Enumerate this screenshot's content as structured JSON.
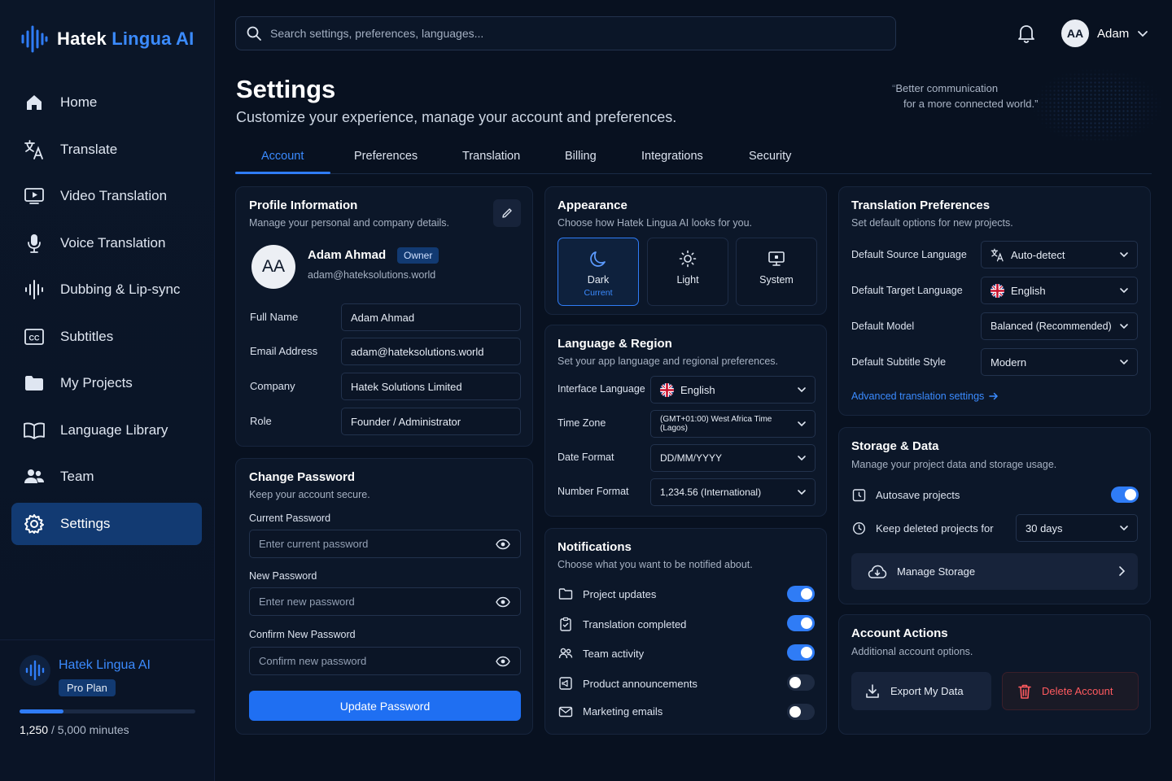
{
  "app": {
    "brand_main": "Hatek",
    "brand_accent": "Lingua AI",
    "accent_color": "#2f7cf6",
    "background_color": "#081120"
  },
  "sidebar": {
    "items": [
      {
        "label": "Home",
        "icon": "home-icon"
      },
      {
        "label": "Translate",
        "icon": "translate-icon"
      },
      {
        "label": "Video Translation",
        "icon": "video-icon"
      },
      {
        "label": "Voice Translation",
        "icon": "microphone-icon"
      },
      {
        "label": "Dubbing & Lip-sync",
        "icon": "waveform-icon"
      },
      {
        "label": "Subtitles",
        "icon": "cc-icon"
      },
      {
        "label": "My Projects",
        "icon": "folder-icon"
      },
      {
        "label": "Language Library",
        "icon": "book-icon"
      },
      {
        "label": "Team",
        "icon": "team-icon"
      },
      {
        "label": "Settings",
        "icon": "gear-icon",
        "active": true
      }
    ],
    "plan": {
      "name": "Hatek Lingua AI",
      "badge": "Pro Plan",
      "used": "1,250",
      "total": "/ 5,000 minutes",
      "used_fraction": 0.25
    }
  },
  "header": {
    "search_placeholder": "Search settings, preferences, languages...",
    "user_initials": "AA",
    "user_name": "Adam"
  },
  "page": {
    "title": "Settings",
    "subtitle": "Customize your experience, manage your account and preferences.",
    "quote_line1": "Better communication",
    "quote_line2": "for a more connected world.”",
    "quote_mark": "“"
  },
  "tabs": [
    {
      "label": "Account",
      "active": true
    },
    {
      "label": "Preferences"
    },
    {
      "label": "Translation"
    },
    {
      "label": "Billing"
    },
    {
      "label": "Integrations"
    },
    {
      "label": "Security"
    }
  ],
  "profile": {
    "title": "Profile Information",
    "subtitle": "Manage your personal and company details.",
    "initials": "AA",
    "name": "Adam Ahmad",
    "badge": "Owner",
    "email": "adam@hateksolutions.world",
    "fields": [
      {
        "label": "Full Name",
        "value": "Adam Ahmad"
      },
      {
        "label": "Email Address",
        "value": "adam@hateksolutions.world"
      },
      {
        "label": "Company",
        "value": "Hatek Solutions Limited"
      },
      {
        "label": "Role",
        "value": "Founder / Administrator"
      }
    ]
  },
  "password": {
    "title": "Change Password",
    "subtitle": "Keep your account secure.",
    "fields": [
      {
        "label": "Current Password",
        "placeholder": "Enter current password"
      },
      {
        "label": "New Password",
        "placeholder": "Enter new password"
      },
      {
        "label": "Confirm New Password",
        "placeholder": "Confirm new password"
      }
    ],
    "button": "Update Password"
  },
  "appearance": {
    "title": "Appearance",
    "subtitle": "Choose how Hatek Lingua AI looks for you.",
    "options": [
      {
        "label": "Dark",
        "caption": "Current",
        "icon": "moon-icon",
        "active": true
      },
      {
        "label": "Light",
        "icon": "sun-icon"
      },
      {
        "label": "System",
        "icon": "monitor-icon"
      }
    ]
  },
  "region": {
    "title": "Language & Region",
    "subtitle": "Set your app language and regional preferences.",
    "rows": [
      {
        "label": "Interface Language",
        "value": "English",
        "flag": true
      },
      {
        "label": "Time Zone",
        "value": "(GMT+01:00) West Africa Time (Lagos)"
      },
      {
        "label": "Date Format",
        "value": "DD/MM/YYYY"
      },
      {
        "label": "Number Format",
        "value": "1,234.56 (International)"
      }
    ]
  },
  "notifications": {
    "title": "Notifications",
    "subtitle": "Choose what you want to be notified about.",
    "items": [
      {
        "label": "Project updates",
        "icon": "folder-icon",
        "on": true
      },
      {
        "label": "Translation completed",
        "icon": "clipboard-check-icon",
        "on": true
      },
      {
        "label": "Team activity",
        "icon": "team-icon",
        "on": true
      },
      {
        "label": "Product announcements",
        "icon": "megaphone-icon",
        "on": false
      },
      {
        "label": "Marketing emails",
        "icon": "mail-icon",
        "on": false
      }
    ]
  },
  "translation_prefs": {
    "title": "Translation Preferences",
    "subtitle": "Set default options for new projects.",
    "rows": [
      {
        "label": "Default Source Language",
        "value": "Auto-detect",
        "icon": "translate-icon"
      },
      {
        "label": "Default Target Language",
        "value": "English",
        "flag": true
      },
      {
        "label": "Default Model",
        "value": "Balanced (Recommended)"
      },
      {
        "label": "Default Subtitle Style",
        "value": "Modern"
      }
    ],
    "link": "Advanced translation settings"
  },
  "storage": {
    "title": "Storage & Data",
    "subtitle": "Manage your project data and storage usage.",
    "autosave_label": "Autosave projects",
    "autosave_on": true,
    "keep_label": "Keep deleted projects for",
    "keep_value": "30 days",
    "manage_label": "Manage Storage"
  },
  "actions": {
    "title": "Account Actions",
    "subtitle": "Additional account options.",
    "export_label": "Export My Data",
    "delete_label": "Delete Account",
    "danger_color": "#ff5a5f"
  }
}
